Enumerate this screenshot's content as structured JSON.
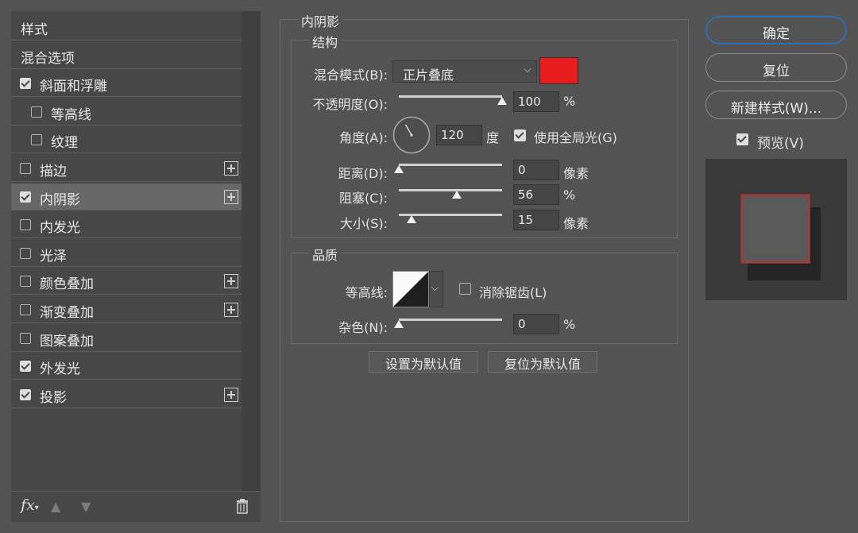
{
  "style_list": {
    "items": [
      {
        "label": "样式",
        "has_checkbox": false,
        "checked": false,
        "indent": false,
        "has_plus": false,
        "selected": false
      },
      {
        "label": "混合选项",
        "has_checkbox": false,
        "checked": false,
        "indent": false,
        "has_plus": false,
        "selected": false
      },
      {
        "label": "斜面和浮雕",
        "has_checkbox": true,
        "checked": true,
        "indent": false,
        "has_plus": false,
        "selected": false
      },
      {
        "label": "等高线",
        "has_checkbox": true,
        "checked": false,
        "indent": true,
        "has_plus": false,
        "selected": false
      },
      {
        "label": "纹理",
        "has_checkbox": true,
        "checked": false,
        "indent": true,
        "has_plus": false,
        "selected": false
      },
      {
        "label": "描边",
        "has_checkbox": true,
        "checked": false,
        "indent": false,
        "has_plus": true,
        "selected": false
      },
      {
        "label": "内阴影",
        "has_checkbox": true,
        "checked": true,
        "indent": false,
        "has_plus": true,
        "selected": true
      },
      {
        "label": "内发光",
        "has_checkbox": true,
        "checked": false,
        "indent": false,
        "has_plus": false,
        "selected": false
      },
      {
        "label": "光泽",
        "has_checkbox": true,
        "checked": false,
        "indent": false,
        "has_plus": false,
        "selected": false
      },
      {
        "label": "颜色叠加",
        "has_checkbox": true,
        "checked": false,
        "indent": false,
        "has_plus": true,
        "selected": false
      },
      {
        "label": "渐变叠加",
        "has_checkbox": true,
        "checked": false,
        "indent": false,
        "has_plus": true,
        "selected": false
      },
      {
        "label": "图案叠加",
        "has_checkbox": true,
        "checked": false,
        "indent": false,
        "has_plus": false,
        "selected": false
      },
      {
        "label": "外发光",
        "has_checkbox": true,
        "checked": true,
        "indent": false,
        "has_plus": false,
        "selected": false
      },
      {
        "label": "投影",
        "has_checkbox": true,
        "checked": true,
        "indent": false,
        "has_plus": true,
        "selected": false
      }
    ],
    "fx_label": "fx"
  },
  "inner_shadow": {
    "title": "内阴影",
    "structure": {
      "title": "结构",
      "blend_mode_label": "混合模式(B):",
      "blend_mode_value": "正片叠底",
      "shadow_color": "#e81c1c",
      "opacity_label": "不透明度(O):",
      "opacity_value": "100",
      "opacity_unit": "%",
      "opacity_fraction": 1.0,
      "angle_label": "角度(A):",
      "angle_value": "120",
      "angle_unit": "度",
      "angle_degrees": 120,
      "global_light_label": "使用全局光(G)",
      "global_light_checked": true,
      "distance_label": "距离(D):",
      "distance_value": "0",
      "distance_unit": "像素",
      "distance_fraction": 0.0,
      "choke_label": "阻塞(C):",
      "choke_value": "56",
      "choke_unit": "%",
      "choke_fraction": 0.56,
      "size_label": "大小(S):",
      "size_value": "15",
      "size_unit": "像素",
      "size_fraction": 0.12
    },
    "quality": {
      "title": "品质",
      "contour_label": "等高线:",
      "anti_alias_label": "消除锯齿(L)",
      "anti_alias_checked": false,
      "noise_label": "杂色(N):",
      "noise_value": "0",
      "noise_unit": "%",
      "noise_fraction": 0.0
    },
    "make_default_label": "设置为默认值",
    "reset_default_label": "复位为默认值"
  },
  "actions": {
    "ok_label": "确定",
    "reset_label": "复位",
    "new_style_label": "新建样式(W)...",
    "preview_label": "预览(V)",
    "preview_checked": true
  }
}
